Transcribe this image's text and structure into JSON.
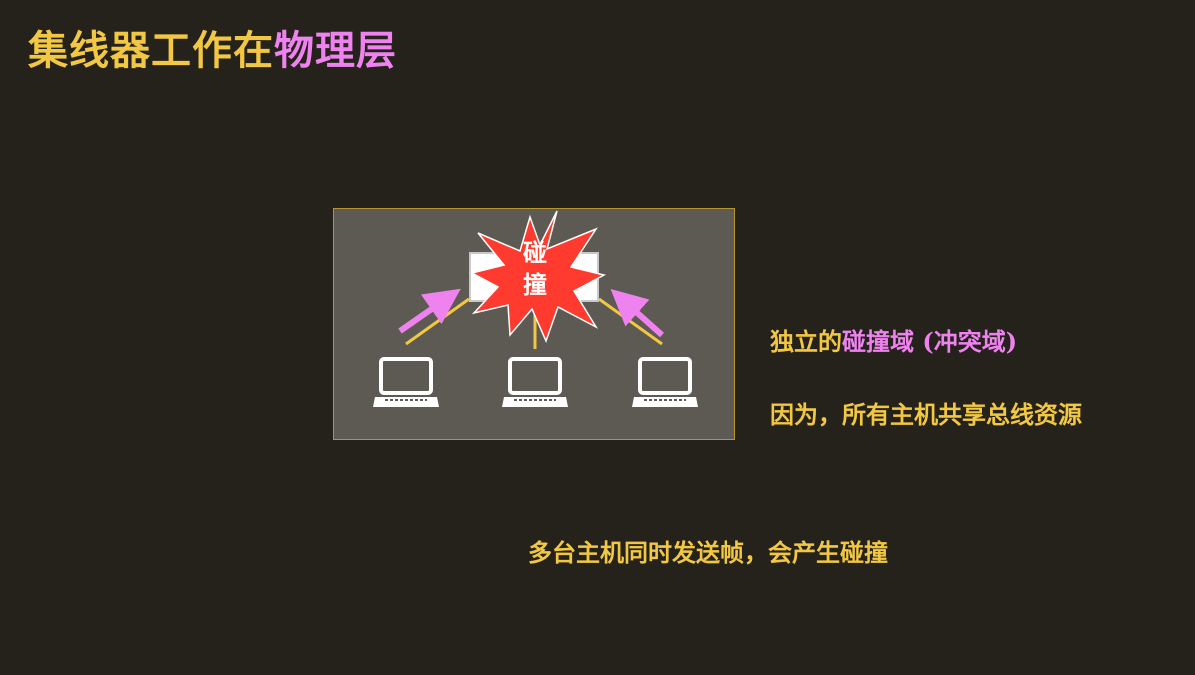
{
  "slide": {
    "title_part1": "集线器工作在",
    "title_part2": "物理层"
  },
  "diagram": {
    "collision_label_line1": "碰",
    "collision_label_line2": "撞",
    "colors": {
      "panel_bg": "#5d5a53",
      "link_line": "#f2c744",
      "arrow": "#ee82ee",
      "burst": "#ff3b2f",
      "laptop": "#ffffff"
    },
    "icons": [
      "laptop-icon",
      "laptop-icon",
      "laptop-icon",
      "hub-device",
      "collision-burst",
      "arrow-up-right-icon",
      "arrow-up-left-icon"
    ]
  },
  "notes": {
    "line1_part1": "独立的",
    "line1_part2": "碰撞域 (冲突域)",
    "line2": "因为，所有主机共享总线资源",
    "line3": "多台主机同时发送帧，会产生碰撞"
  },
  "colors": {
    "background": "#25221b",
    "yellow": "#f2c744",
    "pink": "#ee82ee"
  }
}
